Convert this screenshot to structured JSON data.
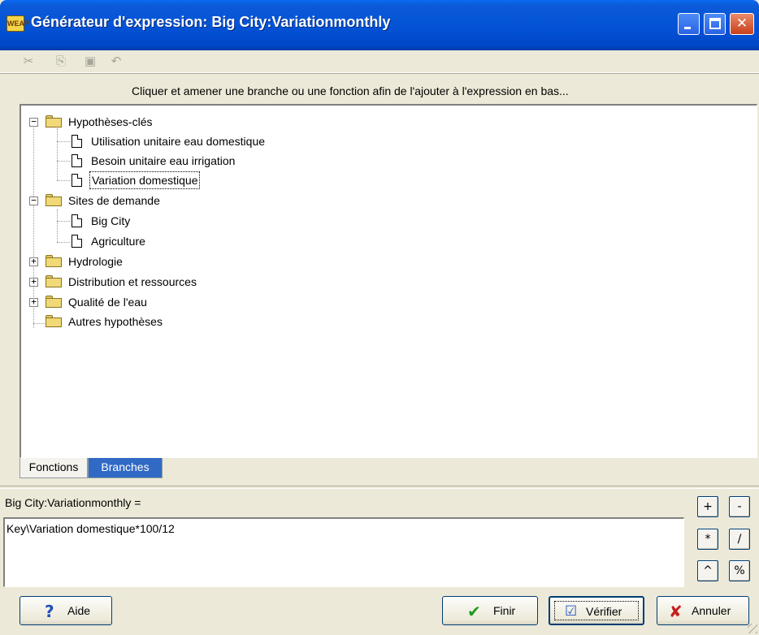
{
  "window": {
    "icon_text": "WEAP",
    "title": "Générateur d'expression: Big City:Variationmonthly",
    "minimize_label": "",
    "maximize_label": "",
    "close_label": "✕"
  },
  "toolbar": {
    "cut_icon": "scissors-icon",
    "copy_icon": "copy-icon",
    "paste_icon": "paste-icon",
    "undo_icon": "undo-icon"
  },
  "hint": "Cliquer et amener une branche ou une fonction afin de l'ajouter à l'expression en bas...",
  "tree": {
    "hypotheses": "Hypothèses-clés",
    "hyp_items": [
      "Utilisation unitaire eau domestique",
      "Besoin unitaire eau irrigation",
      "Variation domestique"
    ],
    "sites": "Sites de demande",
    "site_items": [
      "Big City",
      "Agriculture"
    ],
    "hydrologie": "Hydrologie",
    "distribution": "Distribution et ressources",
    "qualite": "Qualité de l'eau",
    "autres": "Autres hypothèses",
    "selected": "Variation domestique"
  },
  "tabs": {
    "fonctions": "Fonctions",
    "branches": "Branches",
    "active": "Branches"
  },
  "expression": {
    "label": "Big City:Variationmonthly =",
    "value": "Key\\Variation domestique*100/12"
  },
  "operators": [
    "+",
    "-",
    "*",
    "/",
    "^",
    "%"
  ],
  "buttons": {
    "aide": "Aide",
    "finir": "Finir",
    "verifier": "Vérifier",
    "annuler": "Annuler"
  },
  "colors": {
    "titlebar": "#0453d6",
    "active_tab": "#316ac5",
    "window_bg": "#ece9d8"
  }
}
